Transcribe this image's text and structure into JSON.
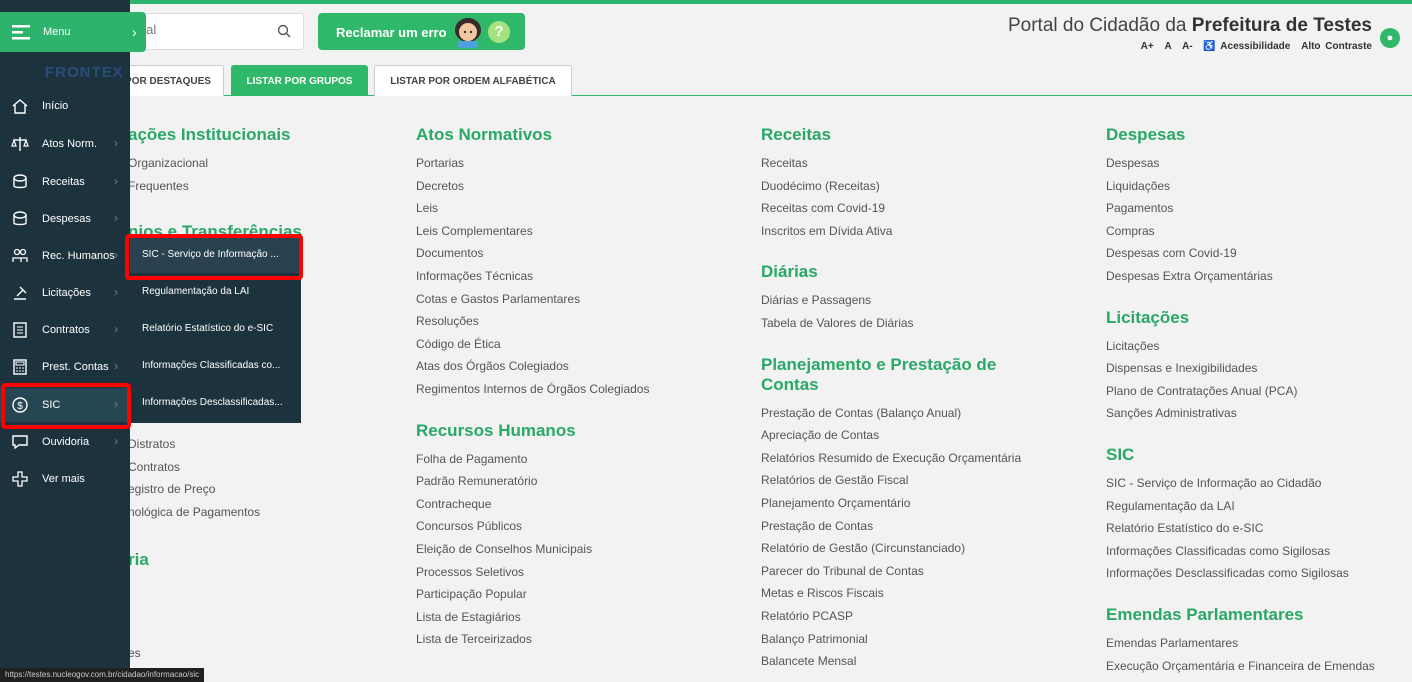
{
  "search": {
    "placeholder": "Pesquisar no Portal",
    "visible_value": "ortal"
  },
  "header": {
    "report_button": "Reclamar um erro",
    "title_prefix": "Portal do Cidadão da",
    "title_entity": "Prefeitura de Testes",
    "accessibility": {
      "a_plus": "A+",
      "a": "A",
      "a_minus": "A-",
      "access": "♿ Acessibilidade",
      "contrast": "Alto Contraste"
    }
  },
  "tabs": [
    {
      "label": "POR DESTAQUES"
    },
    {
      "label": "LISTAR POR GRUPOS"
    },
    {
      "label": "LISTAR POR ORDEM ALFABÉTICA"
    }
  ],
  "sidebar": {
    "menu_label": "Menu",
    "brand": "FRONTEX",
    "items": [
      {
        "label": "Início",
        "icon": "home-icon"
      },
      {
        "label": "Atos Norm.",
        "icon": "scale-icon"
      },
      {
        "label": "Receitas",
        "icon": "coins-icon"
      },
      {
        "label": "Despesas",
        "icon": "coins-icon"
      },
      {
        "label": "Rec. Humanos",
        "icon": "people-icon"
      },
      {
        "label": "Licitações",
        "icon": "gavel-icon"
      },
      {
        "label": "Contratos",
        "icon": "document-icon"
      },
      {
        "label": "Prest. Contas",
        "icon": "calculator-icon"
      },
      {
        "label": "SIC",
        "icon": "dollar-circle-icon"
      },
      {
        "label": "Ouvidoria",
        "icon": "chat-icon"
      },
      {
        "label": "Ver mais",
        "icon": "plus-icon"
      }
    ],
    "submenu": [
      "SIC - Serviço de Informação ...",
      "Regulamentação da LAI",
      "Relatório Estatístico do e-SIC",
      "Informações Classificadas co...",
      "Informações Desclassificadas..."
    ]
  },
  "columns": {
    "col1": [
      {
        "title": "ações Institucionais",
        "links": [
          "Organizacional",
          "Frequentes"
        ]
      },
      {
        "title": "nios e Transferências",
        "links": []
      }
    ],
    "col1_lower": [
      "Distratos",
      "Contratos",
      "egistro de Preço",
      "nológica de Pagamentos"
    ],
    "col1_bottom_title": "ria",
    "col1_last": "es",
    "col2": [
      {
        "title": "Atos Normativos",
        "links": [
          "Portarias",
          "Decretos",
          "Leis",
          "Leis Complementares",
          "Documentos",
          "Informações Técnicas",
          "Cotas e Gastos Parlamentares",
          "Resoluções",
          "Código de Ética",
          "Atas dos Órgãos Colegiados",
          "Regimentos Internos de Órgãos Colegiados"
        ]
      },
      {
        "title": "Recursos Humanos",
        "links": [
          "Folha de Pagamento",
          "Padrão Remuneratório",
          "Contracheque",
          "Concursos Públicos",
          "Eleição de Conselhos Municipais",
          "Processos Seletivos",
          "Participação Popular",
          "Lista de Estagiários",
          "Lista de Terceirizados"
        ]
      }
    ],
    "col3": [
      {
        "title": "Receitas",
        "links": [
          "Receitas",
          "Duodécimo (Receitas)",
          "Receitas com Covid-19",
          "Inscritos em Dívida Ativa"
        ]
      },
      {
        "title": "Diárias",
        "links": [
          "Diárias e Passagens",
          "Tabela de Valores de Diárias"
        ]
      },
      {
        "title": "Planejamento e Prestação de Contas",
        "links": [
          "Prestação de Contas (Balanço Anual)",
          "Apreciação de Contas",
          "Relatórios Resumido de Execução Orçamentária",
          "Relatórios de Gestão Fiscal",
          "Planejamento Orçamentário",
          "Prestação de Contas",
          "Relatório de Gestão (Circunstanciado)",
          "Parecer do Tribunal de Contas",
          "Metas e Riscos Fiscais",
          "Relatório PCASP",
          "Balanço Patrimonial",
          "Balancete Mensal"
        ]
      }
    ],
    "col4": [
      {
        "title": "Despesas",
        "links": [
          "Despesas",
          "Liquidações",
          "Pagamentos",
          "Compras",
          "Despesas com Covid-19",
          "Despesas Extra Orçamentárias"
        ]
      },
      {
        "title": "Licitações",
        "links": [
          "Licitações",
          "Dispensas e Inexigibilidades",
          "Plano de Contratações Anual (PCA)",
          "Sanções Administrativas"
        ]
      },
      {
        "title": "SIC",
        "links": [
          "SIC - Serviço de Informação ao Cidadão",
          "Regulamentação da LAI",
          "Relatório Estatístico do e-SIC",
          "Informações Classificadas como Sigilosas",
          "Informações Desclassificadas como Sigilosas"
        ]
      },
      {
        "title": "Emendas Parlamentares",
        "links": [
          "Emendas Parlamentares",
          "Execução Orçamentária e Financeira de Emendas"
        ]
      }
    ]
  },
  "status_url": "https://testes.nucleogov.com.br/cidadao/informacao/sic",
  "colors": {
    "accent": "#2fb86a",
    "sidebar": "#1c333e",
    "highlight": "#ff0000"
  }
}
